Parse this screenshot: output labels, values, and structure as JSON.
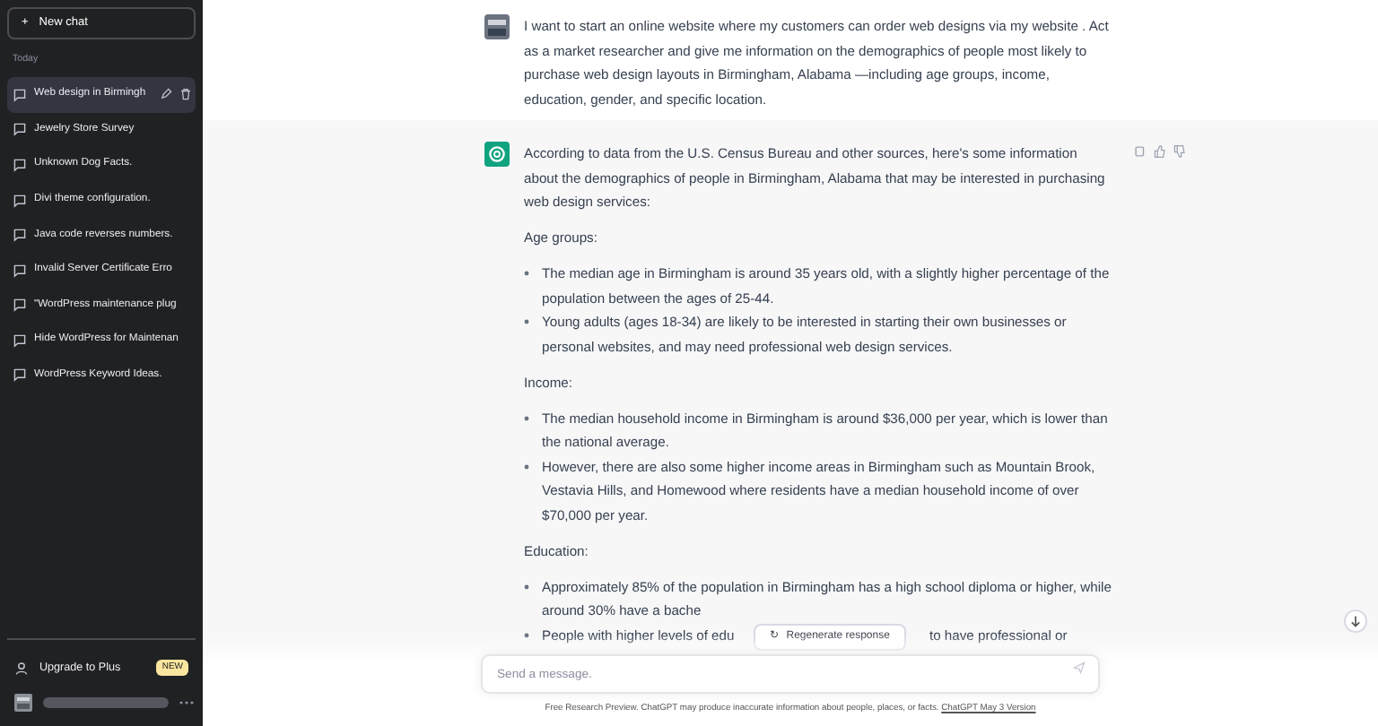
{
  "sidebar": {
    "new_chat": {
      "icon": "+",
      "label": "New chat"
    },
    "section_label": "Today",
    "chats": [
      {
        "title": "Web design in Birmingh",
        "selected": true
      },
      {
        "title": "Jewelry Store Survey",
        "selected": false
      },
      {
        "title": "Unknown Dog Facts.",
        "selected": false
      },
      {
        "title": "Divi theme configuration.",
        "selected": false
      },
      {
        "title": "Java code reverses numbers.",
        "selected": false
      },
      {
        "title": "Invalid Server Certificate Erro",
        "selected": false
      },
      {
        "title": "\"WordPress maintenance plug",
        "selected": false
      },
      {
        "title": "Hide WordPress for Maintenan",
        "selected": false
      },
      {
        "title": "WordPress Keyword Ideas.",
        "selected": false
      }
    ],
    "upgrade": {
      "label": "Upgrade to Plus",
      "badge": "NEW"
    }
  },
  "messages": [
    {
      "kind": "user",
      "blocks": [
        {
          "kind": "paragraph",
          "text": "I want to start an online website where my customers can order web designs via my website . Act as a market researcher and give me information on the demographics of people most likely to purchase web design layouts in Birmingham, Alabama —including age groups, income, education, gender, and specific location."
        }
      ]
    },
    {
      "kind": "assistant",
      "blocks": [
        {
          "kind": "paragraph",
          "text": "According to data from the U.S. Census Bureau and other sources, here's some information about the demographics of people in Birmingham, Alabama that may be interested in purchasing web design services:"
        },
        {
          "kind": "paragraph",
          "text": "Age groups:"
        },
        {
          "kind": "list",
          "items": [
            {
              "text": "The median age in Birmingham is around 35 years old, with a slightly higher percentage of the population between the ages of 25-44."
            },
            {
              "text": "Young adults (ages 18-34) are likely to be interested in starting their own businesses or personal websites, and may need professional web design services."
            }
          ]
        },
        {
          "kind": "paragraph",
          "text": "Income:"
        },
        {
          "kind": "list",
          "items": [
            {
              "text": "The median household income in Birmingham is around $36,000 per year, which is lower than the national average."
            },
            {
              "text": "However, there are also some higher income areas in Birmingham such as Mountain Brook, Vestavia Hills, and Homewood where residents have a median household income of over $70,000 per year."
            }
          ]
        },
        {
          "kind": "paragraph",
          "text": "Education:"
        },
        {
          "kind": "list",
          "items": [
            {
              "text": "Approximately 85% of the population in Birmingham has a high school diploma or higher, while around 30% have a bache"
            },
            {
              "text": "People with higher levels of edu",
              "text_after": "to have professional or"
            }
          ]
        }
      ]
    }
  ],
  "regenerate": {
    "icon": "↻",
    "label": "Regenerate response"
  },
  "composer": {
    "placeholder": "Send a message."
  },
  "footer": {
    "text": "Free Research Preview. ChatGPT may produce inaccurate information about people, places, or facts.",
    "link": "ChatGPT May 3 Version"
  }
}
